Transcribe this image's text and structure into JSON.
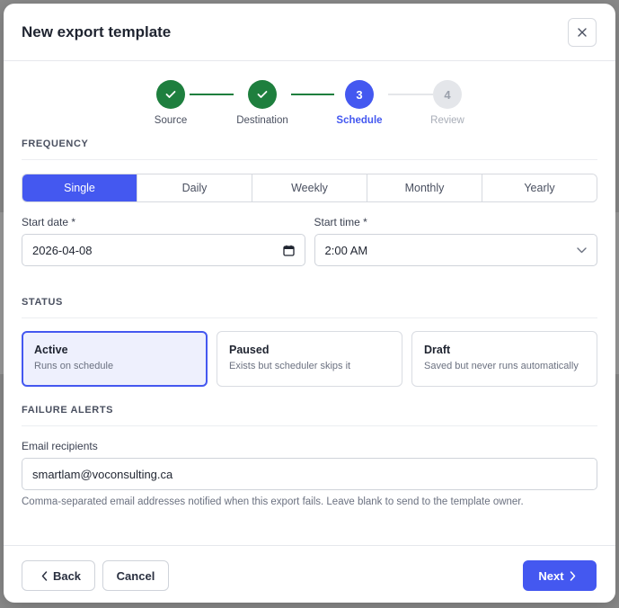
{
  "modal": {
    "title": "New export template"
  },
  "stepper": {
    "steps": [
      {
        "label": "Source",
        "state": "done",
        "marker": ""
      },
      {
        "label": "Destination",
        "state": "done",
        "marker": ""
      },
      {
        "label": "Schedule",
        "state": "current",
        "marker": "3"
      },
      {
        "label": "Review",
        "state": "future",
        "marker": "4"
      }
    ]
  },
  "frequency": {
    "title": "FREQUENCY",
    "options": [
      "Single",
      "Daily",
      "Weekly",
      "Monthly",
      "Yearly"
    ],
    "selected": "Single"
  },
  "start_date": {
    "label": "Start date *",
    "value": "2026-04-08"
  },
  "start_time": {
    "label": "Start time *",
    "value": "2:00 AM"
  },
  "status": {
    "title": "STATUS",
    "selected": "Active",
    "options": [
      {
        "name": "Active",
        "description": "Runs on schedule"
      },
      {
        "name": "Paused",
        "description": "Exists but scheduler skips it"
      },
      {
        "name": "Draft",
        "description": "Saved but never runs automatically"
      }
    ]
  },
  "alerts": {
    "title": "FAILURE ALERTS",
    "email_label": "Email recipients",
    "email_value": "smartlam@voconsulting.ca",
    "help": "Comma-separated email addresses notified when this export fails. Leave blank to send to the template owner."
  },
  "footer": {
    "back_label": "Back",
    "cancel_label": "Cancel",
    "next_label": "Next"
  },
  "colors": {
    "accent": "#4458f0",
    "success": "#1e7f3e"
  }
}
